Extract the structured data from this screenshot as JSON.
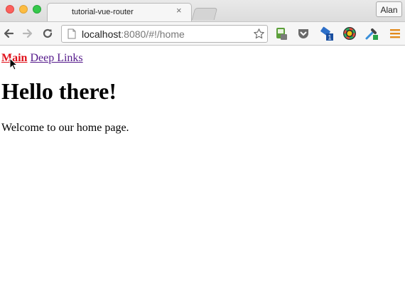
{
  "window": {
    "profile_label": "Alan"
  },
  "tab": {
    "title": "tutorial-vue-router",
    "close_glyph": "×"
  },
  "toolbar": {
    "url_host": "localhost",
    "url_rest": ":8080/#!/home",
    "icons": [
      "back-icon",
      "forward-icon",
      "reload-icon",
      "page-icon",
      "star-icon",
      "extension-evernote-icon",
      "pocket-icon",
      "extension-badge-icon",
      "color-wheel-icon",
      "eyedropper-icon",
      "menu-icon"
    ],
    "extension_badge_count": "1"
  },
  "page": {
    "nav": {
      "main": "Main",
      "deep_links": "Deep Links"
    },
    "heading": "Hello there!",
    "paragraph": "Welcome to our home page."
  },
  "colors": {
    "active_link": "#e0101a",
    "visited_link": "#551a8b"
  }
}
